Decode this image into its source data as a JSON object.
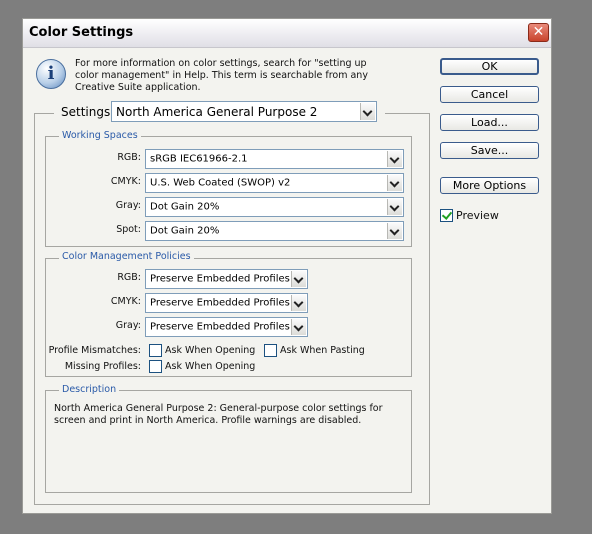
{
  "window": {
    "title": "Color Settings",
    "close_glyph": "✕"
  },
  "info": {
    "icon": "info-icon",
    "text": "For more information on color settings, search for \"setting up color management\" in Help. This term is searchable from any Creative Suite application."
  },
  "settings": {
    "label": "Settings:",
    "value": "North America General Purpose 2"
  },
  "working_spaces": {
    "legend": "Working Spaces",
    "rows": [
      {
        "label": "RGB:",
        "value": "sRGB IEC61966-2.1"
      },
      {
        "label": "CMYK:",
        "value": "U.S. Web Coated (SWOP) v2"
      },
      {
        "label": "Gray:",
        "value": "Dot Gain 20%"
      },
      {
        "label": "Spot:",
        "value": "Dot Gain 20%"
      }
    ]
  },
  "policies": {
    "legend": "Color Management Policies",
    "rows": [
      {
        "label": "RGB:",
        "value": "Preserve Embedded Profiles"
      },
      {
        "label": "CMYK:",
        "value": "Preserve Embedded Profiles"
      },
      {
        "label": "Gray:",
        "value": "Preserve Embedded Profiles"
      }
    ],
    "profile_mismatches_label": "Profile Mismatches:",
    "ask_when_opening": "Ask When Opening",
    "ask_when_pasting": "Ask When Pasting",
    "missing_profiles_label": "Missing Profiles:",
    "missing_ask_when_opening": "Ask When Opening"
  },
  "description": {
    "legend": "Description",
    "text": "North America General Purpose 2:  General-purpose color settings for screen and print in North America. Profile warnings are disabled."
  },
  "buttons": {
    "ok": "OK",
    "cancel": "Cancel",
    "load": "Load...",
    "save": "Save...",
    "more_options": "More Options"
  },
  "preview": {
    "label": "Preview",
    "checked": true
  },
  "colors": {
    "legend_blue": "#2a5aa8",
    "title_close_red": "#c8432c",
    "check_green": "#21a121"
  }
}
